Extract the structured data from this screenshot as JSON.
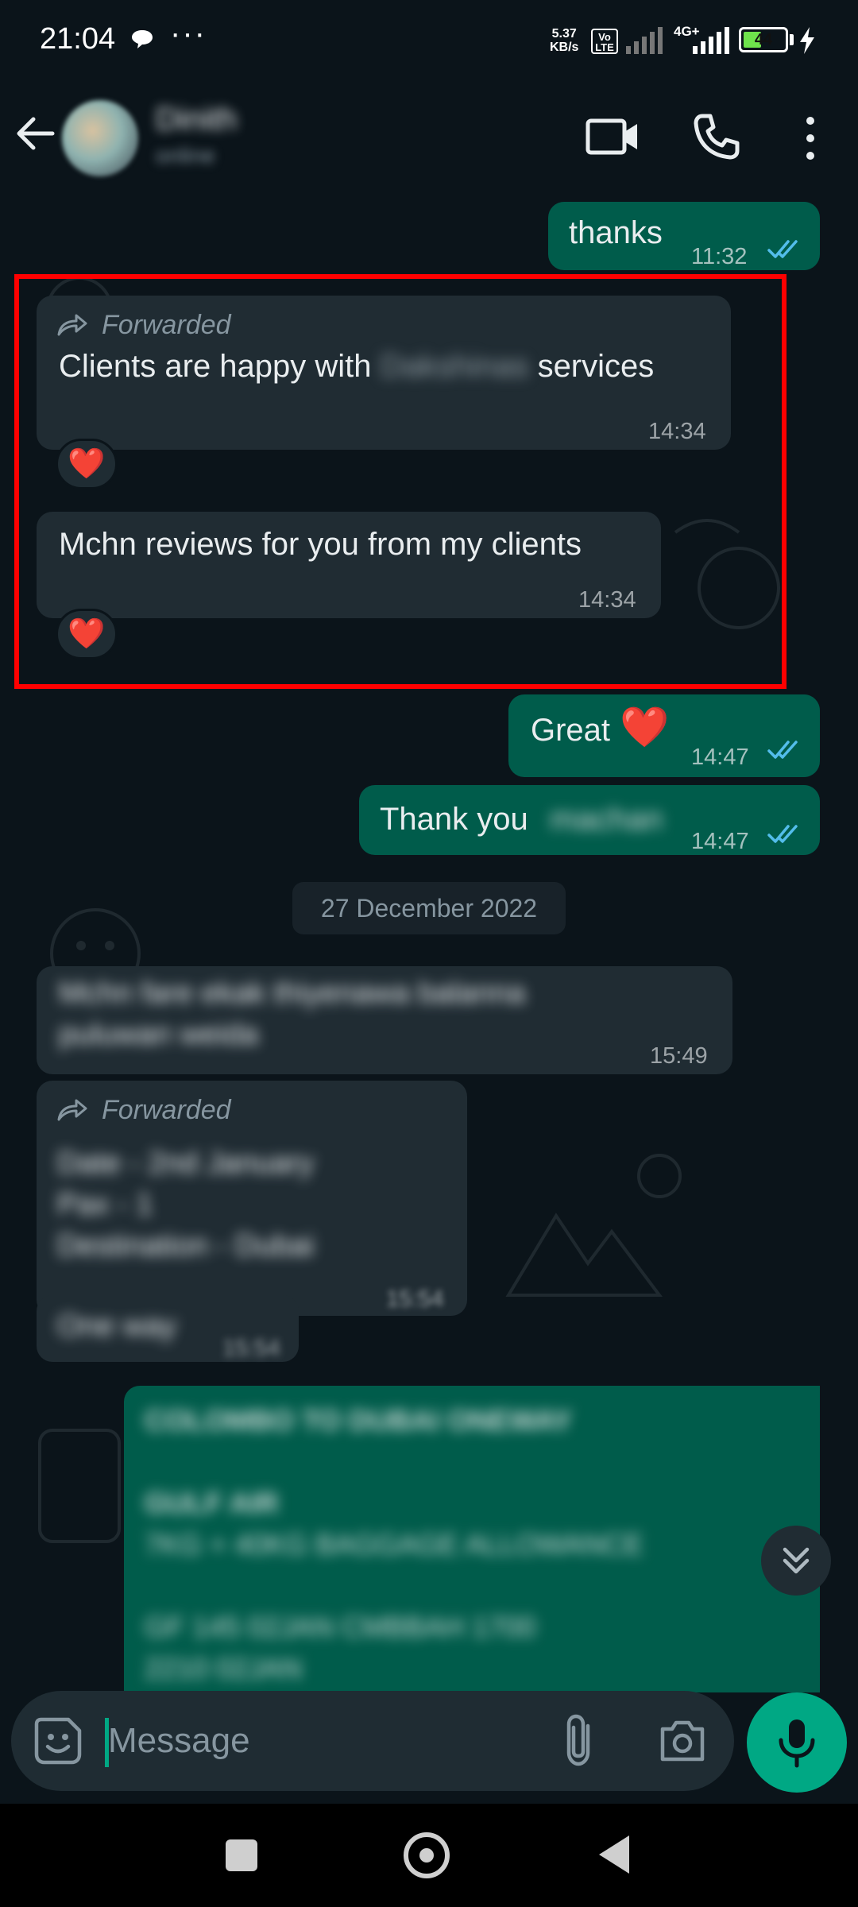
{
  "status_bar": {
    "time": "21:04",
    "dots": "···",
    "net_speed_value": "5.37",
    "net_speed_unit": "KB/s",
    "volte_top": "Vo",
    "volte_bottom": "LTE",
    "network": "4G+",
    "battery": "44"
  },
  "header": {
    "contact_name": "Dinith",
    "contact_status": "online"
  },
  "messages": {
    "m1": {
      "text": "thanks",
      "time": "11:32"
    },
    "m2": {
      "forwarded": "Forwarded",
      "text_before": "Clients are happy with",
      "text_blurred": "Dakshinas",
      "text_after": "services",
      "time": "14:34",
      "reaction": "❤️"
    },
    "m3": {
      "text": "Mchn reviews for you from my clients",
      "time": "14:34",
      "reaction": "❤️"
    },
    "m4": {
      "text": "Great",
      "emoji": "❤️",
      "time": "14:47"
    },
    "m5": {
      "text": "Thank you",
      "text_blurred": "machan",
      "time": "14:47"
    },
    "date_chip": "27 December 2022",
    "m6": {
      "line1": "Mchn fare ekak thiyenawa balanna",
      "line2": "puluwan weida",
      "time": "15:49"
    },
    "m7": {
      "forwarded": "Forwarded",
      "line1": "Date - 2nd January",
      "line2": "Pax - 1",
      "line3": "Destination - Dubai",
      "time": "15:54"
    },
    "m8": {
      "text": "One way",
      "time": "15:54"
    },
    "m9": {
      "line1": "COLOMBO TO DUBAI ONEWAY",
      "line2": "GULF AIR",
      "line3": "7KG + 40KG BAGGAGE ALLOWANCE",
      "line4": "GF 145    02JAN    CMBBAH   1700",
      "line5": "2210   02JAN"
    }
  },
  "input": {
    "placeholder": "Message"
  },
  "colors": {
    "background": "#0b141a",
    "incoming_bubble": "#202c33",
    "outgoing_bubble": "#005c4b",
    "accent": "#00a884",
    "read_tick": "#53bdeb",
    "highlight": "#ff0000"
  }
}
